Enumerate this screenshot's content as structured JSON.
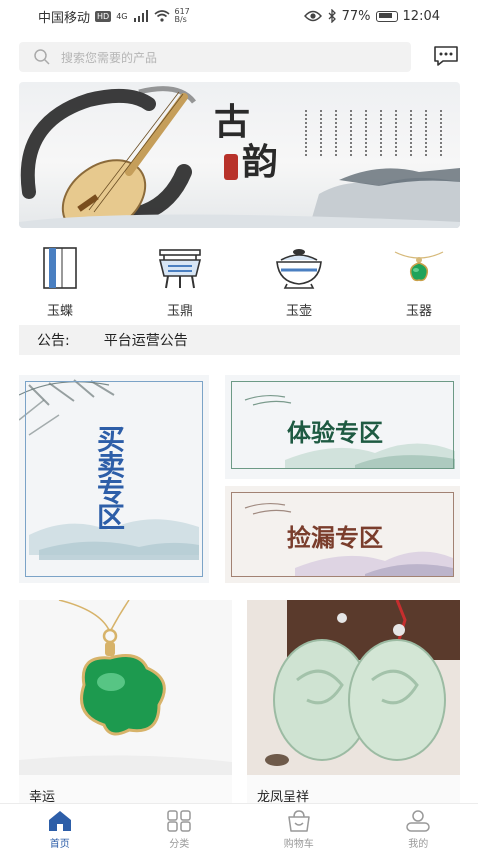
{
  "status_bar": {
    "carrier": "中国移动",
    "hd_badge": "HD",
    "signal_type": "4G",
    "net_speed_value": "617",
    "net_speed_unit": "B/s",
    "battery": "77%",
    "time": "12:04"
  },
  "search": {
    "placeholder": "搜索您需要的产品"
  },
  "banner": {
    "title_line1": "古",
    "title_line2": "韵",
    "accent_color": "#b8322a"
  },
  "categories": [
    {
      "label": "玉蝶",
      "icon": "scroll-book-icon"
    },
    {
      "label": "玉鼎",
      "icon": "tripod-cauldron-icon"
    },
    {
      "label": "玉壶",
      "icon": "jade-pot-icon"
    },
    {
      "label": "玉器",
      "icon": "jade-pendant-icon"
    }
  ],
  "notice": {
    "label": "公告:",
    "text": "平台运营公告"
  },
  "zones": {
    "buy_sell": "买卖专区",
    "experience": "体验专区",
    "bargain": "捡漏专区"
  },
  "products": [
    {
      "name": "幸运"
    },
    {
      "name": "龙凤呈祥"
    }
  ],
  "bottom_nav": [
    {
      "label": "首页",
      "icon": "home-icon",
      "active": true
    },
    {
      "label": "分类",
      "icon": "grid-icon",
      "active": false
    },
    {
      "label": "购物车",
      "icon": "cart-icon",
      "active": false
    },
    {
      "label": "我的",
      "icon": "profile-icon",
      "active": false
    }
  ],
  "colors": {
    "brand_blue": "#2d5ea8",
    "jade_green": "#1fa35a"
  }
}
